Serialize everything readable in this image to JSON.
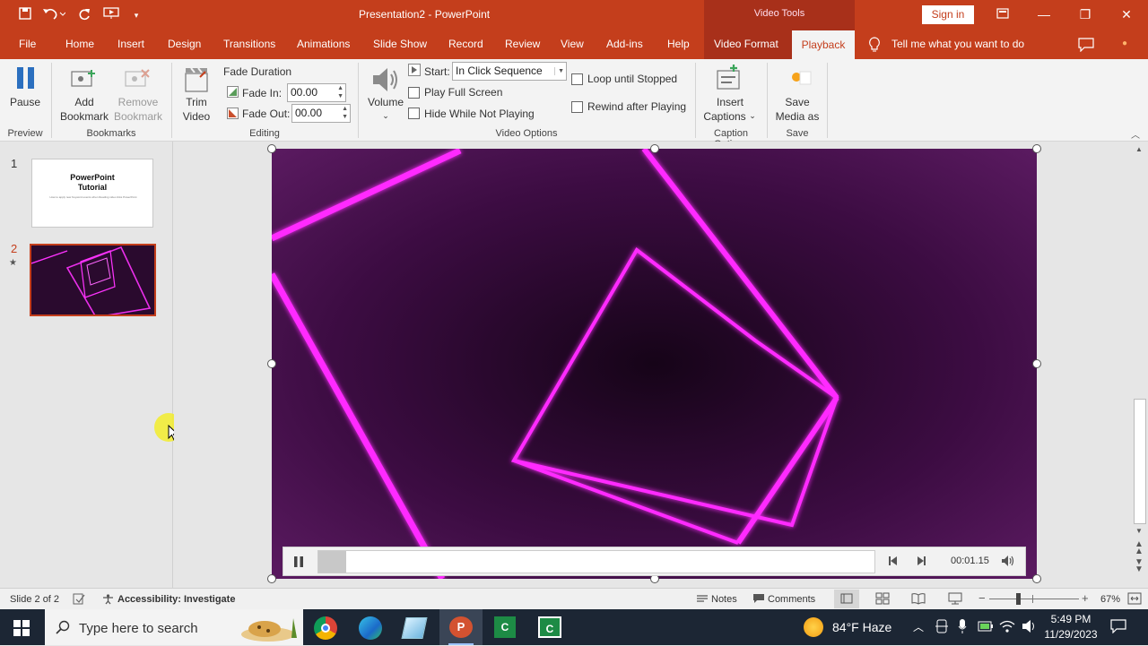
{
  "app": {
    "document_title": "Presentation2  -  PowerPoint",
    "contextual_group": "Video Tools",
    "signin_label": "Sign in"
  },
  "tabs": [
    {
      "label": "File"
    },
    {
      "label": "Home"
    },
    {
      "label": "Insert"
    },
    {
      "label": "Design"
    },
    {
      "label": "Transitions"
    },
    {
      "label": "Animations"
    },
    {
      "label": "Slide Show"
    },
    {
      "label": "Record"
    },
    {
      "label": "Review"
    },
    {
      "label": "View"
    },
    {
      "label": "Add-ins"
    },
    {
      "label": "Help"
    },
    {
      "label": "Video Format"
    },
    {
      "label": "Playback"
    }
  ],
  "tell_me": "Tell me what you want to do",
  "ribbon": {
    "preview": {
      "pause_label": "Pause",
      "group_label": "Preview"
    },
    "bookmarks": {
      "add_label_1": "Add",
      "add_label_2": "Bookmark",
      "remove_label_1": "Remove",
      "remove_label_2": "Bookmark",
      "group_label": "Bookmarks"
    },
    "editing": {
      "trim_label_1": "Trim",
      "trim_label_2": "Video",
      "fade_duration": "Fade Duration",
      "fade_in_label": "Fade In:",
      "fade_in_value": "00.00",
      "fade_out_label": "Fade Out:",
      "fade_out_value": "00.00",
      "group_label": "Editing"
    },
    "video_options": {
      "volume_label": "Volume",
      "start_label": "Start:",
      "start_value": "In Click Sequence",
      "play_full_screen": "Play Full Screen",
      "hide_while_not_playing": "Hide While Not Playing",
      "loop_until_stopped": "Loop until Stopped",
      "rewind_after_playing": "Rewind after Playing",
      "group_label": "Video Options"
    },
    "caption_options": {
      "insert_label_1": "Insert",
      "insert_label_2": "Captions",
      "group_label": "Caption Options"
    },
    "save": {
      "save_label_1": "Save",
      "save_label_2": "Media as",
      "group_label": "Save"
    }
  },
  "slides": [
    {
      "number": "1",
      "title": "PowerPoint Tutorial",
      "title_line1": "PowerPoint",
      "title_line2": "Tutorial",
      "subtitle": "How to apply new Keyword events when Reading video links PowerPoint"
    },
    {
      "number": "2"
    }
  ],
  "player": {
    "time": "00:01.15",
    "progress": 0.05
  },
  "status": {
    "slide_info": "Slide 2 of 2",
    "accessibility": "Accessibility: Investigate",
    "notes": "Notes",
    "comments": "Comments",
    "zoom": "67%"
  },
  "taskbar": {
    "search_placeholder": "Type here to search",
    "weather": "84°F  Haze",
    "time": "5:49 PM",
    "date": "11/29/2023"
  },
  "colors": {
    "accent": "#c43e1c",
    "contextual": "#a8301a",
    "neon": "#ff2cff"
  }
}
